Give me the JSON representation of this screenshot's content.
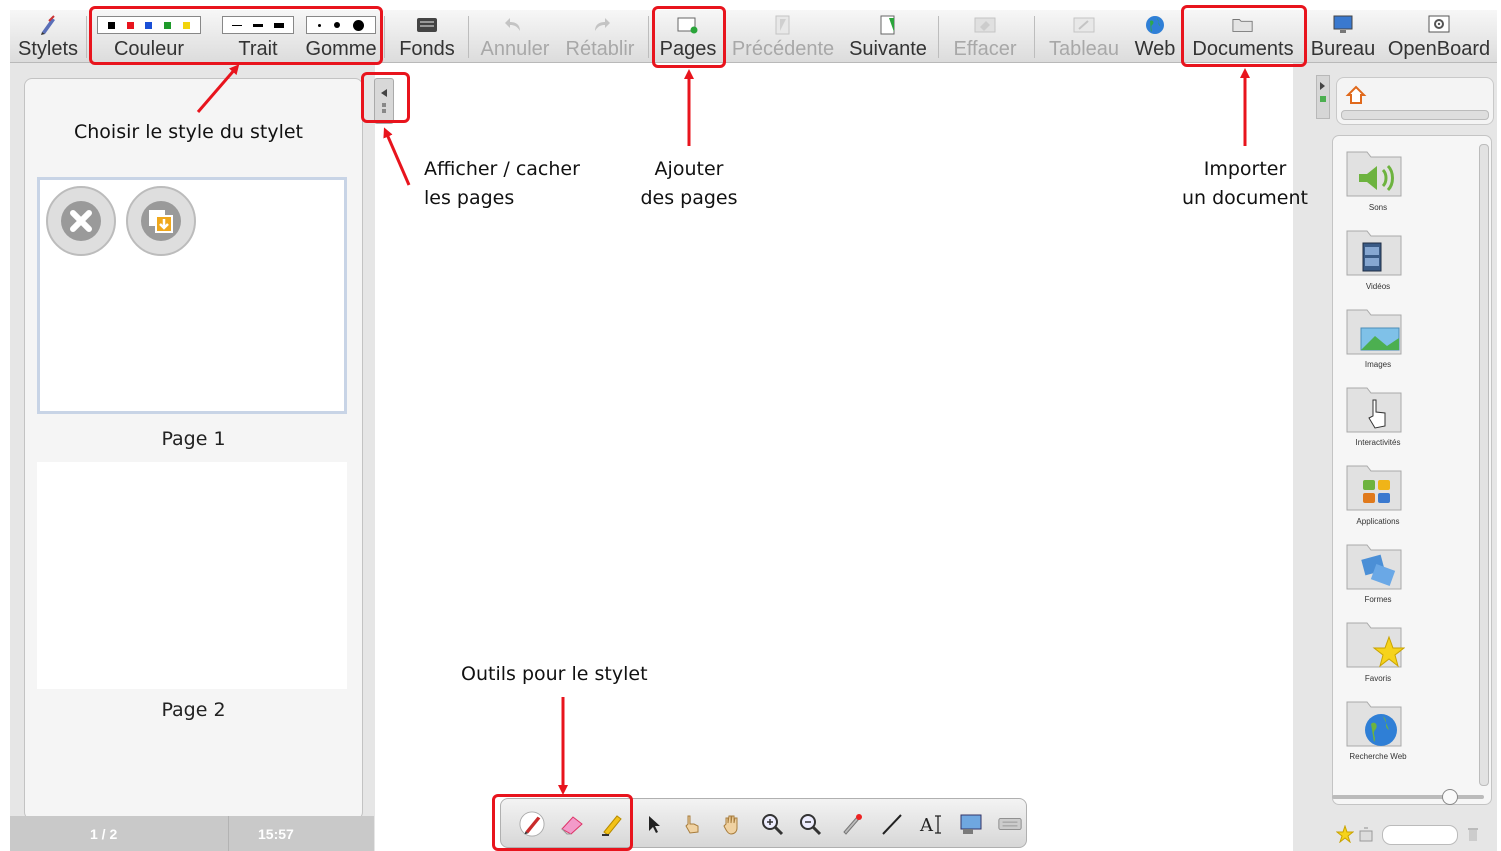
{
  "toolbar": {
    "items": [
      {
        "label": "Stylets",
        "icon": "stylus-icon"
      },
      {
        "label": "Couleur",
        "icon": "color-swatches"
      },
      {
        "label": "Trait",
        "icon": "line-width-icon"
      },
      {
        "label": "Gomme",
        "icon": "eraser-size-icon"
      },
      {
        "label": "Fonds",
        "icon": "background-icon"
      },
      {
        "label": "Annuler",
        "icon": "undo-icon"
      },
      {
        "label": "Rétablir",
        "icon": "redo-icon"
      },
      {
        "label": "Pages",
        "icon": "add-page-icon"
      },
      {
        "label": "Précédente",
        "icon": "previous-page-icon"
      },
      {
        "label": "Suivante",
        "icon": "next-page-icon"
      },
      {
        "label": "Effacer",
        "icon": "clear-icon"
      },
      {
        "label": "Tableau",
        "icon": "board-icon"
      },
      {
        "label": "Web",
        "icon": "globe-icon"
      },
      {
        "label": "Documents",
        "icon": "folder-icon"
      },
      {
        "label": "Bureau",
        "icon": "desktop-icon"
      },
      {
        "label": "OpenBoard",
        "icon": "gear-icon"
      }
    ],
    "colors": [
      "#000000",
      "#e8141d",
      "#1a4fd6",
      "#1e9a2a",
      "#f2d40d"
    ]
  },
  "pages": {
    "thumbs": [
      {
        "label": "Page 1"
      },
      {
        "label": "Page 2"
      }
    ]
  },
  "status": {
    "page_counter": "1 / 2",
    "clock": "15:57"
  },
  "library": {
    "folders": [
      {
        "label": "Sons",
        "icon": "sound-icon"
      },
      {
        "label": "Vidéos",
        "icon": "film-icon"
      },
      {
        "label": "Images",
        "icon": "image-icon"
      },
      {
        "label": "Interactivités",
        "icon": "hand-pointer-icon"
      },
      {
        "label": "Applications",
        "icon": "apps-icon"
      },
      {
        "label": "Formes",
        "icon": "shapes-icon"
      },
      {
        "label": "Favoris",
        "icon": "star-icon"
      },
      {
        "label": "Recherche Web",
        "icon": "globe-icon"
      }
    ]
  },
  "annotations": {
    "stylus_style": "Choisir le style du stylet",
    "toggle_pages_line1": "Afficher / cacher",
    "toggle_pages_line2": "les pages",
    "add_pages_line1": "Ajouter",
    "add_pages_line2": "des pages",
    "import_doc_line1": "Importer",
    "import_doc_line2": "un document",
    "stylus_tools": "Outils pour le stylet"
  }
}
